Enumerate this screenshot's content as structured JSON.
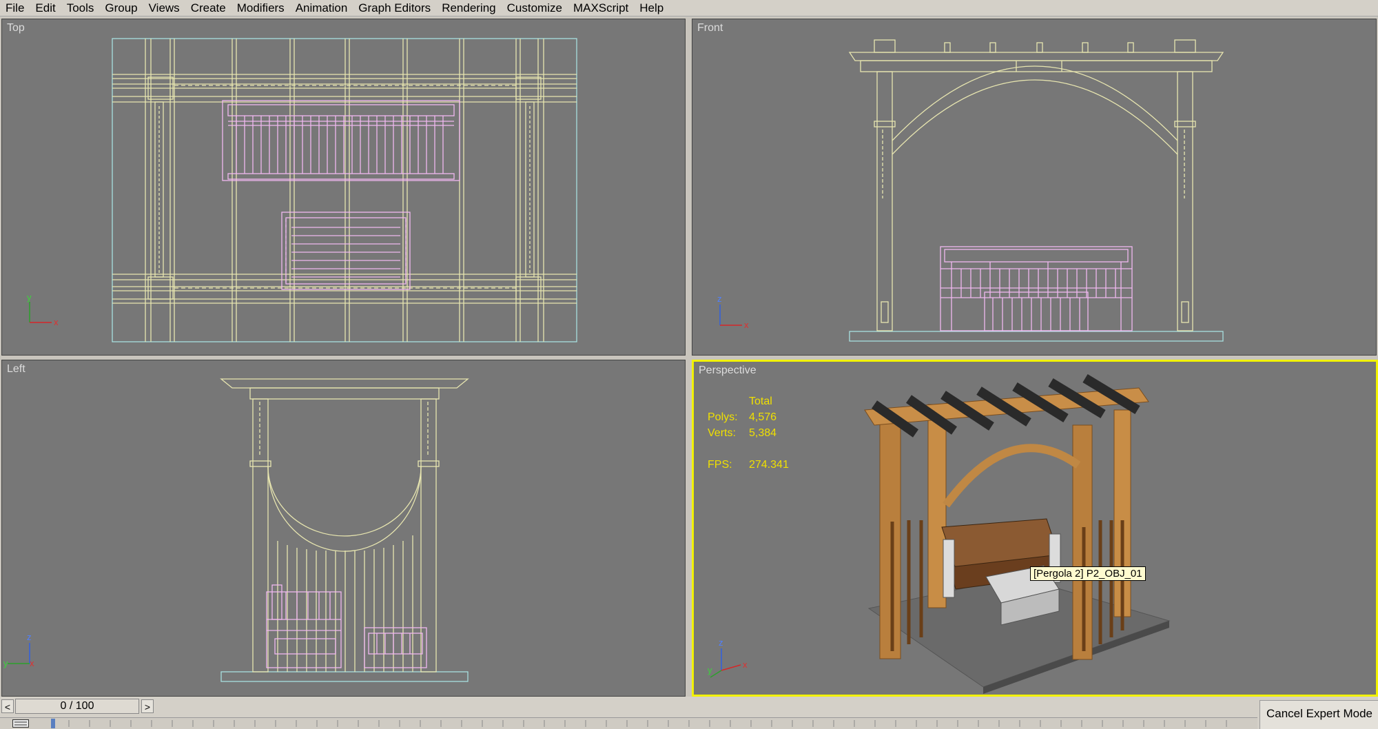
{
  "menu": [
    "File",
    "Edit",
    "Tools",
    "Group",
    "Views",
    "Create",
    "Modifiers",
    "Animation",
    "Graph Editors",
    "Rendering",
    "Customize",
    "MAXScript",
    "Help"
  ],
  "viewports": {
    "top": "Top",
    "front": "Front",
    "left": "Left",
    "perspective": "Perspective"
  },
  "stats": {
    "header": "Total",
    "polys_label": "Polys:",
    "polys": "4,576",
    "verts_label": "Verts:",
    "verts": "5,384",
    "fps_label": "FPS:",
    "fps": "274.341"
  },
  "tooltip": "[Pergola 2] P2_OBJ_01",
  "axes": {
    "x": "x",
    "y": "y",
    "z": "z"
  },
  "timeline": {
    "frame": "0 / 100",
    "prev": "<",
    "next": ">"
  },
  "cancel_expert": "Cancel Expert Mode",
  "colors": {
    "viewport_bg": "#777777",
    "wire_yellow": "#e8e6b0",
    "wire_pink": "#f0b8f0",
    "wire_ground": "#a8e0e0",
    "active_border": "#f2f200",
    "stats_text": "#f0e000"
  }
}
